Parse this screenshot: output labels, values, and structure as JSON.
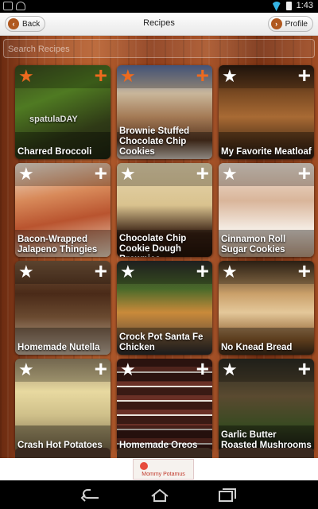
{
  "status_bar": {
    "time": "1:43"
  },
  "header": {
    "back_label": "Back",
    "title": "Recipes",
    "profile_label": "Profile"
  },
  "search": {
    "placeholder": "Search Recipes"
  },
  "cards": [
    {
      "title": "Charred Broccoli",
      "star": "orange",
      "plus": "orange",
      "watermark": "spatulaDAY",
      "bg": "linear-gradient(160deg,#3b4a1e 0%,#4f7a22 35%,#2f3a16 70%,#1f2510 100%)"
    },
    {
      "title": "Brownie Stuffed Chocolate Chip Cookies",
      "star": "orange",
      "plus": "orange",
      "bg": "linear-gradient(180deg,#5a6fa0 0%,#c9b69a 30%,#a47a55 55%,#5b3a24 80%,#d9cfc4 100%)"
    },
    {
      "title": "My Favorite Meatloaf",
      "star": "white",
      "plus": "white",
      "bg": "linear-gradient(180deg,#2a1a10 0%,#7a4a22 30%,#a86a34 55%,#5d3a1c 80%,#2a1a10 100%)"
    },
    {
      "title": "Bacon-Wrapped Jalapeno Thingies",
      "star": "white",
      "plus": "white",
      "bg": "linear-gradient(170deg,#f0e7da 0%,#d88a5a 35%,#b9542f 60%,#f1ddc6 100%)"
    },
    {
      "title": "Chocolate Chip Cookie Dough Brownies",
      "star": "white",
      "plus": "white",
      "bg": "linear-gradient(180deg,#e7d7b0 0%,#d9c28e 45%,#3a2214 75%,#241208 100%)"
    },
    {
      "title": "Cinnamon Roll Sugar Cookies",
      "star": "white",
      "plus": "white",
      "bg": "linear-gradient(180deg,#f2e6da 0%,#d9b59a 40%,#f4ebe2 70%,#c7a589 100%)"
    },
    {
      "title": "Homemade Nutella",
      "star": "white",
      "plus": "white",
      "bg": "linear-gradient(180deg,#7a5a3e 0%,#4a2a18 35%,#6a4a30 60%,#c9b8a4 100%)"
    },
    {
      "title": "Crock Pot Santa Fe Chicken",
      "star": "white",
      "plus": "white",
      "bg": "linear-gradient(180deg,#2a2a2a 0%,#4a6a2a 30%,#c98a3a 55%,#7a5a3a 80%,#2a2a2a 100%)"
    },
    {
      "title": "No Knead Bread",
      "star": "white",
      "plus": "white",
      "bg": "linear-gradient(180deg,#3a2a1a 0%,#caa06a 35%,#e4c89a 55%,#8a5a2a 85%,#3a2a1a 100%)"
    },
    {
      "title": "Crash Hot Potatoes",
      "star": "white",
      "plus": "white",
      "bg": "linear-gradient(180deg,#9a8a6a 0%,#e8d9a0 35%,#cfc08a 60%,#7a6a4a 100%)"
    },
    {
      "title": "Homemade Oreos",
      "star": "white",
      "plus": "white",
      "bg": "repeating-linear-gradient(180deg,#3a1a14 0 10px,#6a3026 10px 16px,#e8e2da 16px 18px)"
    },
    {
      "title": "Garlic Butter Roasted Mushrooms",
      "star": "white",
      "plus": "white",
      "bg": "linear-gradient(180deg,#2a2a22 0%,#5a4a30 40%,#3a4a22 70%,#1a1a14 100%)"
    }
  ],
  "ad": {
    "text": "Mommy Potamus"
  }
}
